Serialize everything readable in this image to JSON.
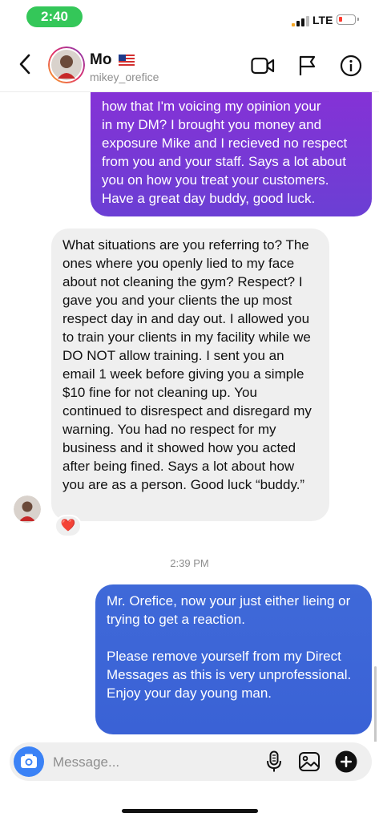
{
  "status_bar": {
    "time": "2:40",
    "network": "LTE",
    "battery_level": "low"
  },
  "header": {
    "name": "Mo",
    "username": "mikey_orefice",
    "icons": [
      "back-chevron-icon",
      "video-call-icon",
      "flag-icon",
      "info-icon"
    ]
  },
  "messages": [
    {
      "direction": "outgoing",
      "text": "how that I'm voicing my opinion your\nin my DM? I brought you money and exposure Mike and I recieved no respect from you and your staff. Says a lot about you on how you treat your customers. Have a great day buddy, good luck."
    },
    {
      "direction": "incoming",
      "text": "What situations are you referring to? The ones where you openly lied to my face about not cleaning the gym? Respect? I gave you and your clients the up most respect day in and day out. I allowed you to train your clients in my facility while we DO NOT allow training. I sent you an email 1 week before giving you a simple $10 fine for not cleaning up. You continued to disrespect and disregard my warning. You had no respect for my business and it showed how you acted after being fined. Says a lot about how you are as a person. Good luck “buddy.”",
      "reaction": "❤️"
    },
    {
      "direction": "outgoing",
      "timestamp": "2:39 PM",
      "text": "Mr. Orefice, now your just either lieing or trying to get a reaction.\n\nPlease remove yourself from my Direct  Messages as this is very unprofessional. Enjoy your day young man."
    }
  ],
  "composer": {
    "placeholder": "Message...",
    "icons": [
      "camera-icon",
      "microphone-icon",
      "gallery-icon",
      "plus-icon"
    ]
  },
  "colors": {
    "time_pill": "#34c759",
    "outgoing_purple": "#7b35d5",
    "outgoing_blue": "#3d66d7",
    "incoming_gray": "#efefef",
    "camera_button": "#3b82f6"
  }
}
